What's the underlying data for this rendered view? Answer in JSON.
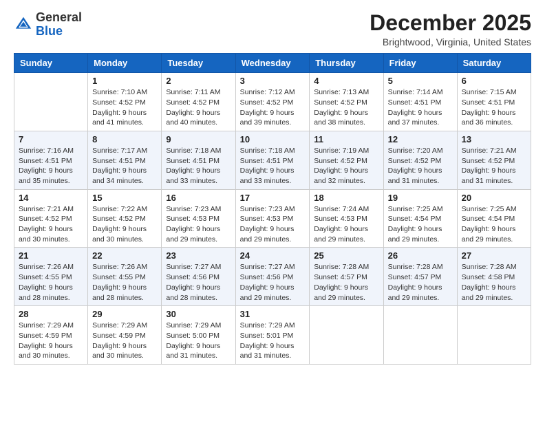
{
  "header": {
    "logo_general": "General",
    "logo_blue": "Blue",
    "month_title": "December 2025",
    "location": "Brightwood, Virginia, United States"
  },
  "days_of_week": [
    "Sunday",
    "Monday",
    "Tuesday",
    "Wednesday",
    "Thursday",
    "Friday",
    "Saturday"
  ],
  "weeks": [
    [
      {
        "day": "",
        "sunrise": "",
        "sunset": "",
        "daylight": ""
      },
      {
        "day": "1",
        "sunrise": "Sunrise: 7:10 AM",
        "sunset": "Sunset: 4:52 PM",
        "daylight": "Daylight: 9 hours and 41 minutes."
      },
      {
        "day": "2",
        "sunrise": "Sunrise: 7:11 AM",
        "sunset": "Sunset: 4:52 PM",
        "daylight": "Daylight: 9 hours and 40 minutes."
      },
      {
        "day": "3",
        "sunrise": "Sunrise: 7:12 AM",
        "sunset": "Sunset: 4:52 PM",
        "daylight": "Daylight: 9 hours and 39 minutes."
      },
      {
        "day": "4",
        "sunrise": "Sunrise: 7:13 AM",
        "sunset": "Sunset: 4:52 PM",
        "daylight": "Daylight: 9 hours and 38 minutes."
      },
      {
        "day": "5",
        "sunrise": "Sunrise: 7:14 AM",
        "sunset": "Sunset: 4:51 PM",
        "daylight": "Daylight: 9 hours and 37 minutes."
      },
      {
        "day": "6",
        "sunrise": "Sunrise: 7:15 AM",
        "sunset": "Sunset: 4:51 PM",
        "daylight": "Daylight: 9 hours and 36 minutes."
      }
    ],
    [
      {
        "day": "7",
        "sunrise": "Sunrise: 7:16 AM",
        "sunset": "Sunset: 4:51 PM",
        "daylight": "Daylight: 9 hours and 35 minutes."
      },
      {
        "day": "8",
        "sunrise": "Sunrise: 7:17 AM",
        "sunset": "Sunset: 4:51 PM",
        "daylight": "Daylight: 9 hours and 34 minutes."
      },
      {
        "day": "9",
        "sunrise": "Sunrise: 7:18 AM",
        "sunset": "Sunset: 4:51 PM",
        "daylight": "Daylight: 9 hours and 33 minutes."
      },
      {
        "day": "10",
        "sunrise": "Sunrise: 7:18 AM",
        "sunset": "Sunset: 4:51 PM",
        "daylight": "Daylight: 9 hours and 33 minutes."
      },
      {
        "day": "11",
        "sunrise": "Sunrise: 7:19 AM",
        "sunset": "Sunset: 4:52 PM",
        "daylight": "Daylight: 9 hours and 32 minutes."
      },
      {
        "day": "12",
        "sunrise": "Sunrise: 7:20 AM",
        "sunset": "Sunset: 4:52 PM",
        "daylight": "Daylight: 9 hours and 31 minutes."
      },
      {
        "day": "13",
        "sunrise": "Sunrise: 7:21 AM",
        "sunset": "Sunset: 4:52 PM",
        "daylight": "Daylight: 9 hours and 31 minutes."
      }
    ],
    [
      {
        "day": "14",
        "sunrise": "Sunrise: 7:21 AM",
        "sunset": "Sunset: 4:52 PM",
        "daylight": "Daylight: 9 hours and 30 minutes."
      },
      {
        "day": "15",
        "sunrise": "Sunrise: 7:22 AM",
        "sunset": "Sunset: 4:52 PM",
        "daylight": "Daylight: 9 hours and 30 minutes."
      },
      {
        "day": "16",
        "sunrise": "Sunrise: 7:23 AM",
        "sunset": "Sunset: 4:53 PM",
        "daylight": "Daylight: 9 hours and 29 minutes."
      },
      {
        "day": "17",
        "sunrise": "Sunrise: 7:23 AM",
        "sunset": "Sunset: 4:53 PM",
        "daylight": "Daylight: 9 hours and 29 minutes."
      },
      {
        "day": "18",
        "sunrise": "Sunrise: 7:24 AM",
        "sunset": "Sunset: 4:53 PM",
        "daylight": "Daylight: 9 hours and 29 minutes."
      },
      {
        "day": "19",
        "sunrise": "Sunrise: 7:25 AM",
        "sunset": "Sunset: 4:54 PM",
        "daylight": "Daylight: 9 hours and 29 minutes."
      },
      {
        "day": "20",
        "sunrise": "Sunrise: 7:25 AM",
        "sunset": "Sunset: 4:54 PM",
        "daylight": "Daylight: 9 hours and 29 minutes."
      }
    ],
    [
      {
        "day": "21",
        "sunrise": "Sunrise: 7:26 AM",
        "sunset": "Sunset: 4:55 PM",
        "daylight": "Daylight: 9 hours and 28 minutes."
      },
      {
        "day": "22",
        "sunrise": "Sunrise: 7:26 AM",
        "sunset": "Sunset: 4:55 PM",
        "daylight": "Daylight: 9 hours and 28 minutes."
      },
      {
        "day": "23",
        "sunrise": "Sunrise: 7:27 AM",
        "sunset": "Sunset: 4:56 PM",
        "daylight": "Daylight: 9 hours and 28 minutes."
      },
      {
        "day": "24",
        "sunrise": "Sunrise: 7:27 AM",
        "sunset": "Sunset: 4:56 PM",
        "daylight": "Daylight: 9 hours and 29 minutes."
      },
      {
        "day": "25",
        "sunrise": "Sunrise: 7:28 AM",
        "sunset": "Sunset: 4:57 PM",
        "daylight": "Daylight: 9 hours and 29 minutes."
      },
      {
        "day": "26",
        "sunrise": "Sunrise: 7:28 AM",
        "sunset": "Sunset: 4:57 PM",
        "daylight": "Daylight: 9 hours and 29 minutes."
      },
      {
        "day": "27",
        "sunrise": "Sunrise: 7:28 AM",
        "sunset": "Sunset: 4:58 PM",
        "daylight": "Daylight: 9 hours and 29 minutes."
      }
    ],
    [
      {
        "day": "28",
        "sunrise": "Sunrise: 7:29 AM",
        "sunset": "Sunset: 4:59 PM",
        "daylight": "Daylight: 9 hours and 30 minutes."
      },
      {
        "day": "29",
        "sunrise": "Sunrise: 7:29 AM",
        "sunset": "Sunset: 4:59 PM",
        "daylight": "Daylight: 9 hours and 30 minutes."
      },
      {
        "day": "30",
        "sunrise": "Sunrise: 7:29 AM",
        "sunset": "Sunset: 5:00 PM",
        "daylight": "Daylight: 9 hours and 31 minutes."
      },
      {
        "day": "31",
        "sunrise": "Sunrise: 7:29 AM",
        "sunset": "Sunset: 5:01 PM",
        "daylight": "Daylight: 9 hours and 31 minutes."
      },
      {
        "day": "",
        "sunrise": "",
        "sunset": "",
        "daylight": ""
      },
      {
        "day": "",
        "sunrise": "",
        "sunset": "",
        "daylight": ""
      },
      {
        "day": "",
        "sunrise": "",
        "sunset": "",
        "daylight": ""
      }
    ]
  ]
}
